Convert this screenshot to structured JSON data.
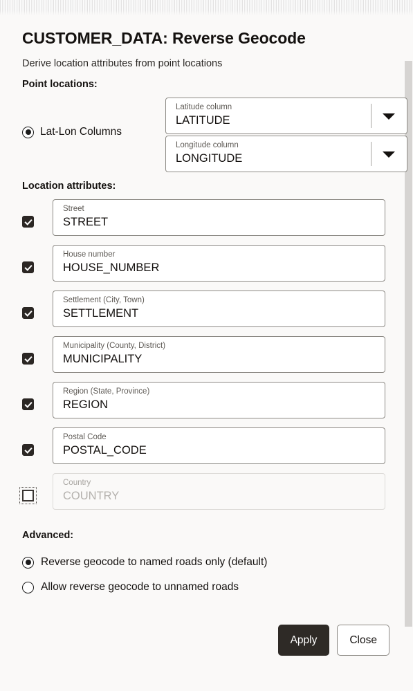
{
  "header": {
    "title": "CUSTOMER_DATA: Reverse Geocode",
    "subtitle": "Derive location attributes from point locations"
  },
  "point_locations": {
    "section_label": "Point locations:",
    "radio_label": "Lat-Lon Columns",
    "radio_selected": true,
    "dropdowns": [
      {
        "caption": "Latitude column",
        "value": "LATITUDE"
      },
      {
        "caption": "Longitude column",
        "value": "LONGITUDE"
      }
    ]
  },
  "location_attributes": {
    "section_label": "Location attributes:",
    "rows": [
      {
        "caption": "Street",
        "value": "STREET",
        "checked": true,
        "enabled": true
      },
      {
        "caption": "House number",
        "value": "HOUSE_NUMBER",
        "checked": true,
        "enabled": true
      },
      {
        "caption": "Settlement (City, Town)",
        "value": "SETTLEMENT",
        "checked": true,
        "enabled": true
      },
      {
        "caption": "Municipality (County, District)",
        "value": "MUNICIPALITY",
        "checked": true,
        "enabled": true
      },
      {
        "caption": "Region (State, Province)",
        "value": "REGION",
        "checked": true,
        "enabled": true
      },
      {
        "caption": "Postal Code",
        "value": "POSTAL_CODE",
        "checked": true,
        "enabled": true
      },
      {
        "caption": "Country",
        "value": "COUNTRY",
        "checked": false,
        "enabled": false
      }
    ]
  },
  "advanced": {
    "section_label": "Advanced:",
    "options": [
      {
        "label": "Reverse geocode to named roads only (default)",
        "selected": true
      },
      {
        "label": "Allow reverse geocode to unnamed roads",
        "selected": false
      }
    ]
  },
  "footer": {
    "apply_label": "Apply",
    "close_label": "Close"
  },
  "icons": {
    "dropdown_arrow": "chevron-down-icon",
    "checkmark": "check-icon"
  },
  "colors": {
    "background": "#faf9f8",
    "field_background": "#ffffff",
    "field_border": "#8c8984",
    "primary_button": "#2e2a26",
    "text": "#14110f",
    "caption_text": "#5e5a55",
    "disabled_text": "#b4b1ad",
    "scrollbar_thumb": "#d6d4d2"
  }
}
